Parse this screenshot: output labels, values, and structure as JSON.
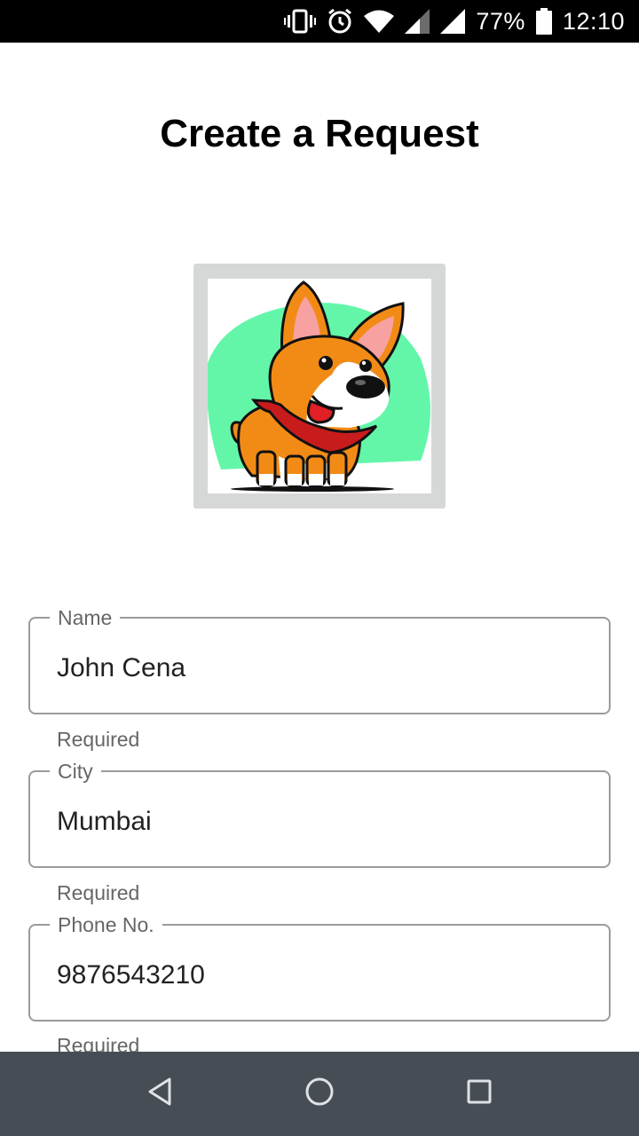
{
  "status_bar": {
    "battery_percent": "77%",
    "time": "12:10",
    "icons": [
      "vibrate-icon",
      "alarm-icon",
      "wifi-icon",
      "cell-signal-icon",
      "cell-signal-icon",
      "battery-icon"
    ]
  },
  "page": {
    "title": "Create a Request"
  },
  "avatar": {
    "icon": "corgi-dog-illustration",
    "frame_color": "#d6d8d7",
    "blob_color": "#63f6a9"
  },
  "form": {
    "fields": [
      {
        "label": "Name",
        "value": "John Cena",
        "helper": "Required"
      },
      {
        "label": "City",
        "value": "Mumbai",
        "helper": "Required"
      },
      {
        "label": "Phone No.",
        "value": "9876543210",
        "helper": "Required"
      }
    ]
  },
  "nav_bar": {
    "color": "#464d54",
    "buttons": [
      "back-icon",
      "home-icon",
      "recents-icon"
    ]
  }
}
